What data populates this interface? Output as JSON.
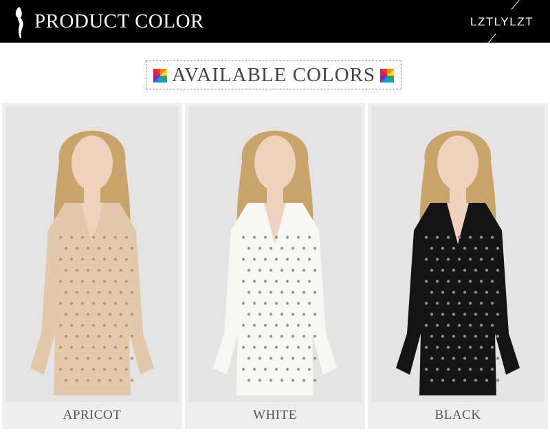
{
  "header": {
    "title": "PRODUCT COLOR",
    "brand": "LZTLYLZT",
    "logo_icon": "woman-silhouette-icon"
  },
  "banner": {
    "text": "AVAILABLE COLORS",
    "icon": "color-palette-icon"
  },
  "products": [
    {
      "label": "APRICOT",
      "dress_color": "#e3c9ab",
      "sequin_color": "#b89a6a"
    },
    {
      "label": "WHITE",
      "dress_color": "#f7f7f4",
      "sequin_color": "#9a9a96"
    },
    {
      "label": "BLACK",
      "dress_color": "#141414",
      "sequin_color": "#8a8a8a"
    }
  ],
  "colors": {
    "header_bg": "#000000",
    "hair": "#c9a46a",
    "skin": "#efd2bd"
  }
}
